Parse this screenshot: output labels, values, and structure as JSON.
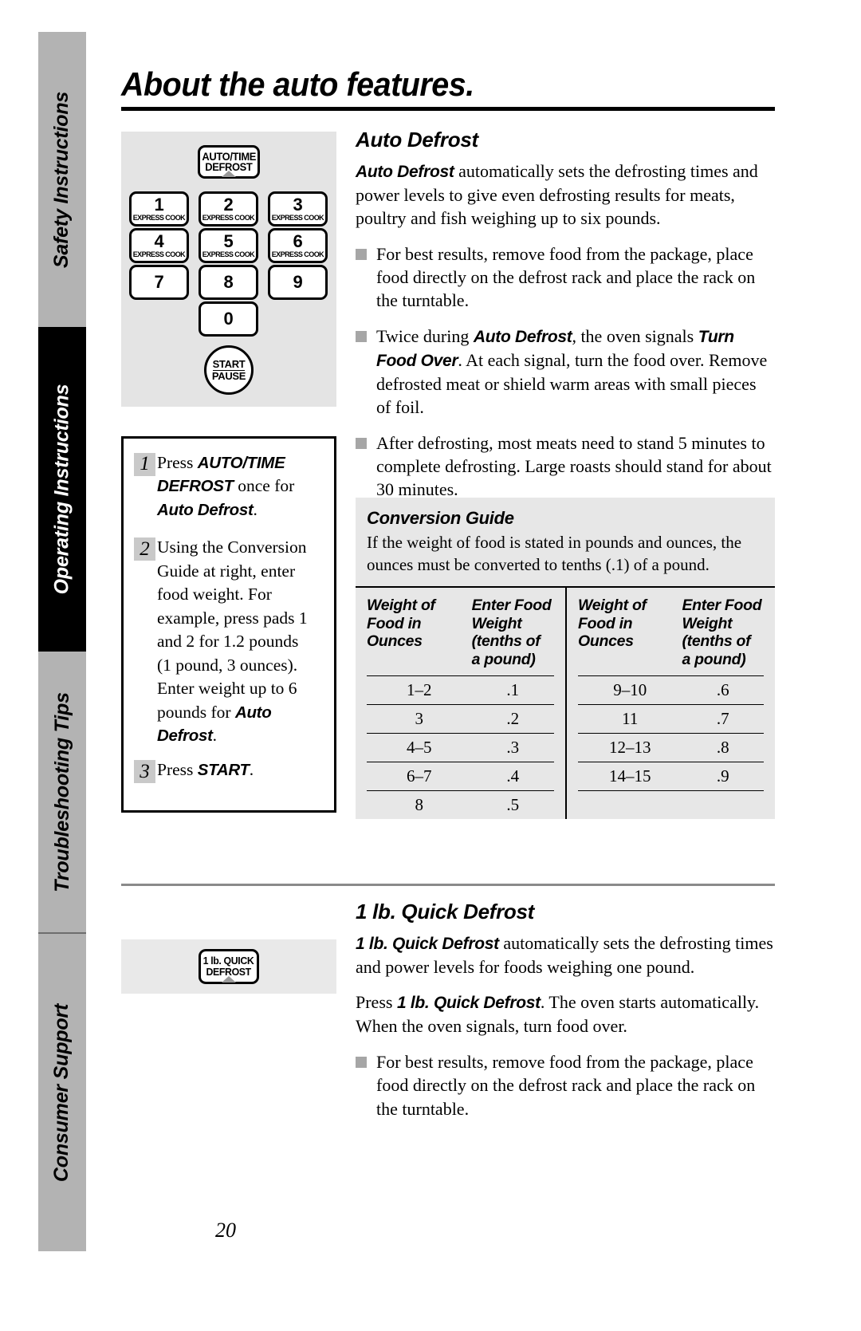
{
  "sidebar": {
    "tabs": [
      {
        "label": "Safety Instructions",
        "active": false
      },
      {
        "label": "Operating Instructions",
        "active": true
      },
      {
        "label": "Troubleshooting Tips",
        "active": false
      },
      {
        "label": "Consumer Support",
        "active": false
      }
    ]
  },
  "page": {
    "title": "About the auto features.",
    "number": "20"
  },
  "keypad": {
    "defrost_button": {
      "line1": "AUTO/TIME",
      "line2": "DEFROST"
    },
    "keys": [
      {
        "num": "1",
        "sub": "EXPRESS COOK"
      },
      {
        "num": "2",
        "sub": "EXPRESS COOK"
      },
      {
        "num": "3",
        "sub": "EXPRESS COOK"
      },
      {
        "num": "4",
        "sub": "EXPRESS COOK"
      },
      {
        "num": "5",
        "sub": "EXPRESS COOK"
      },
      {
        "num": "6",
        "sub": "EXPRESS COOK"
      },
      {
        "num": "7",
        "sub": ""
      },
      {
        "num": "8",
        "sub": ""
      },
      {
        "num": "9",
        "sub": ""
      },
      {
        "num": "0",
        "sub": ""
      }
    ],
    "start_button": {
      "line1": "START",
      "line2": "PAUSE"
    }
  },
  "steps": {
    "items": [
      {
        "number": "1",
        "parts": [
          {
            "text": "Press ",
            "style": "normal"
          },
          {
            "text": "AUTO/TIME DEFROST",
            "style": "bold-italic"
          },
          {
            "text": " once for ",
            "style": "normal"
          },
          {
            "text": "Auto Defrost",
            "style": "bold-italic"
          },
          {
            "text": ".",
            "style": "normal"
          }
        ]
      },
      {
        "number": "2",
        "parts": [
          {
            "text": "Using the Conversion Guide at right, enter food weight. For example, press pads 1 and 2 for 1.2 pounds (1 pound, 3 ounces). Enter weight up to 6 pounds for ",
            "style": "normal"
          },
          {
            "text": "Auto Defrost",
            "style": "bold-italic"
          },
          {
            "text": ".",
            "style": "normal"
          }
        ]
      },
      {
        "number": "3",
        "parts": [
          {
            "text": "Press ",
            "style": "normal"
          },
          {
            "text": "START",
            "style": "bold-italic"
          },
          {
            "text": ".",
            "style": "normal"
          }
        ]
      }
    ]
  },
  "auto_defrost": {
    "heading": "Auto Defrost",
    "intro": {
      "lead": "Auto Defrost",
      "rest": " automatically sets the defrosting times and power levels to give even defrosting results for meats, poultry and fish weighing up to six pounds."
    },
    "bullets": [
      {
        "parts": [
          {
            "text": "For best results, remove food from the package, place food directly on the defrost rack and place the rack on the turntable.",
            "style": "normal"
          }
        ]
      },
      {
        "parts": [
          {
            "text": "Twice during ",
            "style": "normal"
          },
          {
            "text": "Auto Defrost",
            "style": "bold-italic"
          },
          {
            "text": ", the oven signals ",
            "style": "normal"
          },
          {
            "text": "Turn Food Over",
            "style": "bold-italic"
          },
          {
            "text": ". At each signal, turn the food over. Remove defrosted meat or shield warm areas with small pieces of foil.",
            "style": "normal"
          }
        ]
      },
      {
        "parts": [
          {
            "text": "After defrosting, most meats need to stand 5 minutes to complete defrosting. Large roasts should stand for about 30 minutes.",
            "style": "normal"
          }
        ]
      }
    ]
  },
  "conversion_guide": {
    "heading": "Conversion Guide",
    "description": "If the weight of food is stated in pounds and ounces, the ounces must be converted to tenths (.1) of a pound.",
    "columns": [
      "Weight of Food in Ounces",
      "Enter Food Weight (tenths of a pound)"
    ],
    "column_header_lines": {
      "left": [
        "Weight of",
        "Food in",
        "Ounces"
      ],
      "right": [
        "Enter Food",
        "Weight",
        "(tenths of",
        "a pound)"
      ]
    },
    "left_table": [
      {
        "ounces": "1–2",
        "tenths": ".1"
      },
      {
        "ounces": "3",
        "tenths": ".2"
      },
      {
        "ounces": "4–5",
        "tenths": ".3"
      },
      {
        "ounces": "6–7",
        "tenths": ".4"
      },
      {
        "ounces": "8",
        "tenths": ".5"
      }
    ],
    "right_table": [
      {
        "ounces": "9–10",
        "tenths": ".6"
      },
      {
        "ounces": "11",
        "tenths": ".7"
      },
      {
        "ounces": "12–13",
        "tenths": ".8"
      },
      {
        "ounces": "14–15",
        "tenths": ".9"
      }
    ]
  },
  "quick_defrost": {
    "button": {
      "line1": "1 lb. QUICK",
      "line2": "DEFROST"
    },
    "heading": "1 lb. Quick Defrost",
    "intro": {
      "lead": "1 lb. Quick Defrost",
      "rest": " automatically sets the defrosting times and power levels for foods weighing one pound."
    },
    "press_paragraph": {
      "pre": "Press ",
      "lead": "1 lb. Quick Defrost",
      "rest": ". The oven starts automatically. When the oven signals, turn food over."
    },
    "bullets": [
      {
        "text": "For best results, remove food from the package, place food directly on the defrost rack and place the rack on the turntable."
      }
    ]
  },
  "colors": {
    "sidebar_inactive": "#b3b3b3",
    "sidebar_active": "#000000",
    "panel_gray": "#e4e4e4",
    "table_gray": "#e7e7e7",
    "bullet_gray": "#a6a6a6",
    "step_num_gray": "#c9c9c9",
    "rule_gray": "#8a8a8a"
  }
}
